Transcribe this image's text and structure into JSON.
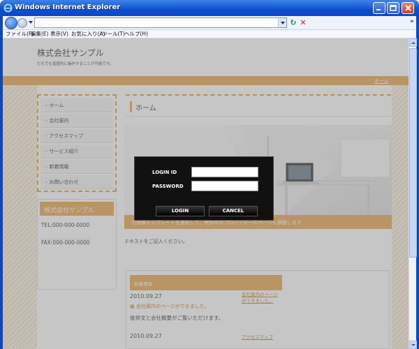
{
  "window": {
    "title": "Windows Internet Explorer",
    "colors": {
      "titlebar": "#0a49c2",
      "close": "#c9402a"
    }
  },
  "toolbar": {
    "address_value": "",
    "more_label": "»"
  },
  "menu": {
    "items": [
      "ファイル(F)",
      "編集(E)",
      "表示(V)",
      "お気に入り(A)",
      "ツール(T)",
      "ヘルプ(H)"
    ]
  },
  "site": {
    "title": "株式会社サンプル",
    "tagline": "だれでも直感的に操作することが可能です。",
    "home_link": "ホーム",
    "accent_color": "#e8a54e",
    "nav": [
      "ホーム",
      "会社案内",
      "アクセスマップ",
      "サービス紹介",
      "新着情報",
      "お問い合わせ"
    ],
    "company": {
      "name": "株式会社サンプル",
      "tel": "TEL:000-000-0000",
      "fax": "FAX:000-000-0000"
    },
    "main_title": "ホーム",
    "banner_text": "旦那様テンプレートを選択して、使用中のプロバイダーのページも連動します",
    "body_text": "テキストをご記入ください。",
    "news": {
      "heading": "新着情報",
      "date": "2010.09.27",
      "item": "会社案内のページができました。",
      "desc": "挨拶文と会社概要がご覧いただけます。",
      "link": "会社案内のページができました。",
      "next_date": "2010.09.27",
      "next_link": "アクセスマップ"
    }
  },
  "login": {
    "id_label": "LOGIN ID",
    "password_label": "PASSWORD",
    "id_value": "",
    "password_value": "",
    "login_button": "LOGIN",
    "cancel_button": "CANCEL"
  }
}
